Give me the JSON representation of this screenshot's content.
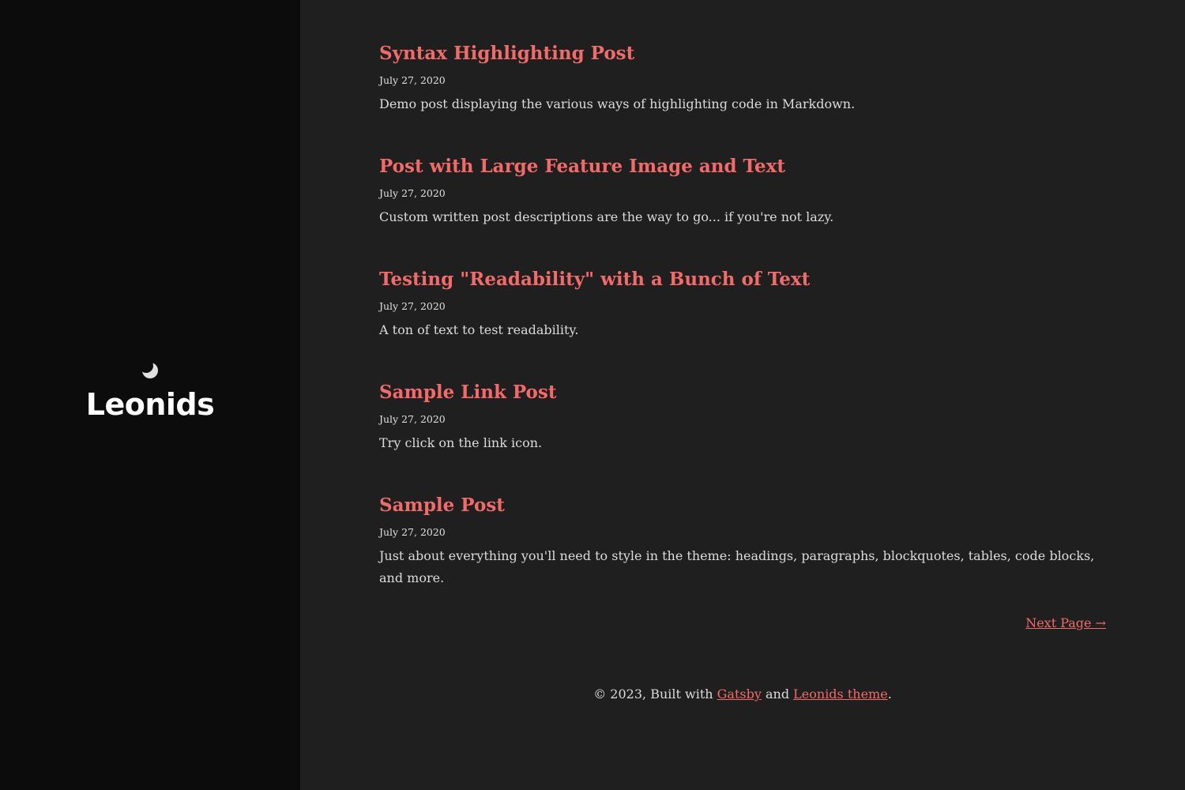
{
  "site": {
    "title": "Leonids",
    "theme_icon": "moon-icon"
  },
  "colors": {
    "accent": "#f26b6b",
    "sidebar_bg": "#0c0c0c",
    "main_bg": "#1f1f1f",
    "text": "#dcdcdc"
  },
  "posts": [
    {
      "title": "Syntax Highlighting Post",
      "date": "July 27, 2020",
      "description": "Demo post displaying the various ways of highlighting code in Markdown."
    },
    {
      "title": "Post with Large Feature Image and Text",
      "date": "July 27, 2020",
      "description": "Custom written post descriptions are the way to go... if you're not lazy."
    },
    {
      "title": "Testing \"Readability\" with a Bunch of Text",
      "date": "July 27, 2020",
      "description": "A ton of text to test readability."
    },
    {
      "title": "Sample Link Post",
      "date": "July 27, 2020",
      "description": "Try click on the link icon."
    },
    {
      "title": "Sample Post",
      "date": "July 27, 2020",
      "description": "Just about everything you'll need to style in the theme: headings, paragraphs, blockquotes, tables, code blocks, and more."
    }
  ],
  "pagination": {
    "next_label": "Next Page →"
  },
  "footer": {
    "prefix": "© 2023, Built with ",
    "gatsby_link": "Gatsby",
    "middle": " and ",
    "theme_link": "Leonids theme",
    "suffix": "."
  }
}
